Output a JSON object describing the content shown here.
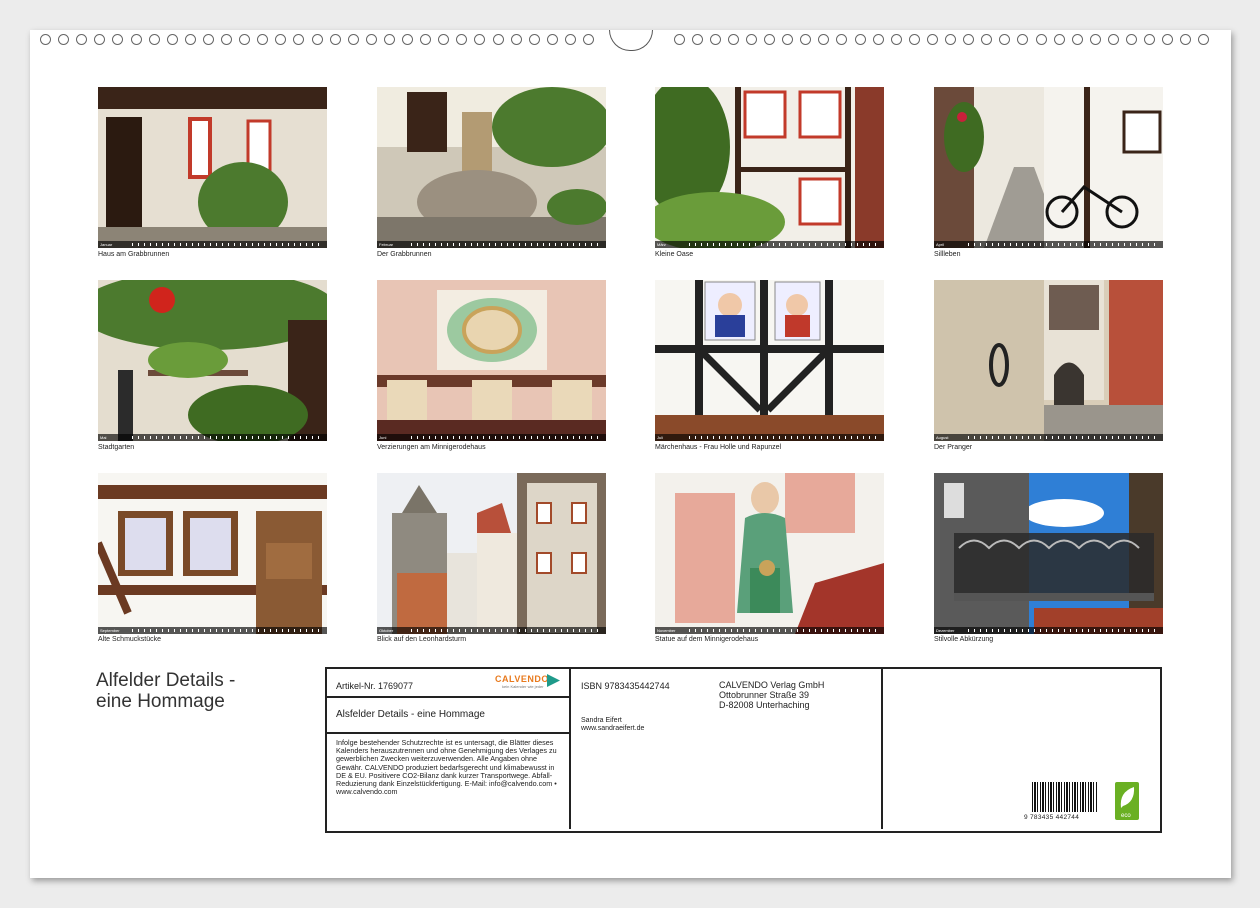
{
  "photos": [
    {
      "caption": "Haus am Grabbrunnen",
      "month": "Januar"
    },
    {
      "caption": "Der Grabbrunnen",
      "month": "Februar"
    },
    {
      "caption": "Kleine Oase",
      "month": "März"
    },
    {
      "caption": "Sillleben",
      "month": "April"
    },
    {
      "caption": "Stadtgarten",
      "month": "Mai"
    },
    {
      "caption": "Verzierungen am Minnigerodehaus",
      "month": "Juni"
    },
    {
      "caption": "Märchenhaus - Frau Holle und Rapunzel",
      "month": "Juli"
    },
    {
      "caption": "Der Pranger",
      "month": "August"
    },
    {
      "caption": "Alte Schmuckstücke",
      "month": "September"
    },
    {
      "caption": "Blick auf den Leonhardsturm",
      "month": "Oktober"
    },
    {
      "caption": "Statue auf dem Minnigerodehaus",
      "month": "November"
    },
    {
      "caption": "Stilvolle Abkürzung",
      "month": "Dezember"
    }
  ],
  "title_line1": "Alfelder Details -",
  "title_line2": "eine Hommage",
  "info": {
    "artikel": "Artikel-Nr. 1769077",
    "brand": "CALVENDO",
    "brand_sub": "kein Kalender wie jeder",
    "product_title": "Alsfelder Details - eine Hommage",
    "legal": "Infolge bestehender Schutzrechte ist es untersagt, die Blätter dieses Kalenders herauszutrennen und ohne Genehmigung des Verlages zu gewerblichen Zwecken weiterzuverwenden. Alle Angaben ohne Gewähr. CALVENDO produziert bedarfsgerecht und klimabewusst in DE & EU. Positivere CO2-Bilanz dank kurzer Transportwege. Abfall-Reduzierung dank Einzelstückfertigung. E-Mail: info@calvendo.com • www.calvendo.com",
    "isbn": "ISBN 9783435442744",
    "publisher_1": "CALVENDO Verlag GmbH",
    "publisher_2": "Ottobrunner Straße 39",
    "publisher_3": "D-82008 Unterhaching",
    "author": "Sandra Eifert",
    "website": "www.sandraeifert.de",
    "barcode_number": "9 783435 442744",
    "eco_label": "eco"
  },
  "colors": {
    "timber": "#3a2418",
    "plaster": "#f2efe8",
    "green": "#4c7a2e",
    "sky": "#2f7fd6",
    "eco": "#6ab023",
    "brand": "#e87a1e"
  }
}
